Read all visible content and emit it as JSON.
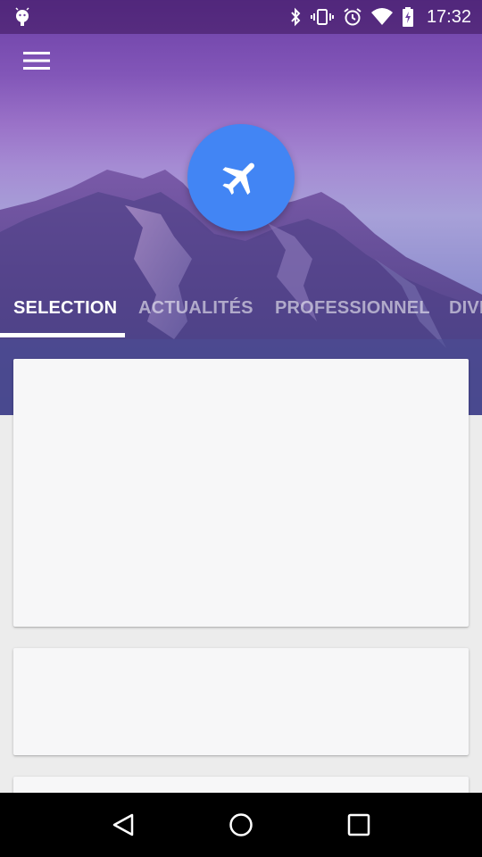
{
  "status_bar": {
    "time": "17:32",
    "icons": [
      "android-debug-icon",
      "bluetooth-icon",
      "vibrate-icon",
      "alarm-icon",
      "wifi-icon",
      "battery-charging-icon"
    ]
  },
  "header": {
    "menu_icon": "hamburger-menu-icon",
    "fab_icon": "airplane-icon",
    "fab_color": "#4285f4"
  },
  "tabs": [
    {
      "label": "SELECTION",
      "active": true
    },
    {
      "label": "ACTUALITÉS",
      "active": false
    },
    {
      "label": "PROFESSIONNEL",
      "active": false
    },
    {
      "label": "DIVE",
      "active": false
    }
  ],
  "cards_count_visible": 3,
  "nav_bar": {
    "back_icon": "back-triangle-icon",
    "home_icon": "home-circle-icon",
    "recents_icon": "recents-square-icon"
  }
}
